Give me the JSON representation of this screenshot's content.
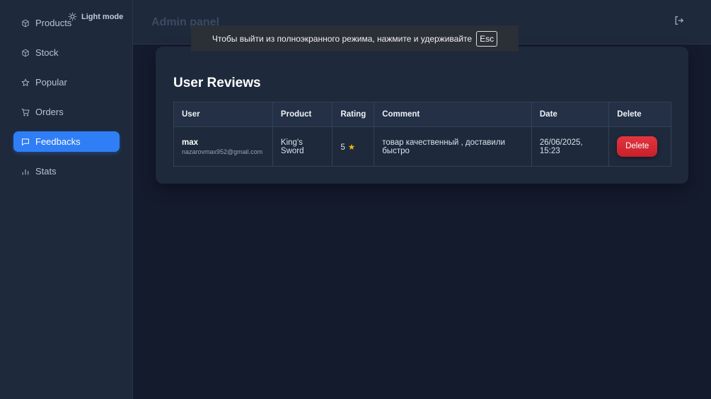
{
  "sidebar": {
    "light_mode_label": "Light mode",
    "items": [
      {
        "label": "Products",
        "icon": "box-icon"
      },
      {
        "label": "Stock",
        "icon": "box-icon"
      },
      {
        "label": "Popular",
        "icon": "star-icon"
      },
      {
        "label": "Orders",
        "icon": "cart-icon"
      },
      {
        "label": "Feedbacks",
        "icon": "chat-icon",
        "active": true
      },
      {
        "label": "Stats",
        "icon": "bar-chart-icon"
      }
    ]
  },
  "header": {
    "title": "Admin panel",
    "logout_icon": "logout-icon"
  },
  "fullscreen_notice": {
    "text": "Чтобы выйти из полноэкранного режима, нажмите и удерживайте",
    "key": "Esc"
  },
  "reviews": {
    "title": "User Reviews",
    "columns": [
      "User",
      "Product",
      "Rating",
      "Comment",
      "Date",
      "Delete"
    ],
    "rows": [
      {
        "user_name": "max",
        "user_email": "nazarovmax952@gmail.com",
        "product": "King's Sword",
        "rating": "5",
        "comment": "товар качественный , доставили быстро",
        "date": "26/06/2025, 15:23",
        "delete_label": "Delete"
      }
    ]
  },
  "colors": {
    "accent": "#2f7ef6",
    "danger": "#d9303a",
    "star": "#f5b800",
    "background": "#141b2d",
    "panel": "#1e293b"
  }
}
